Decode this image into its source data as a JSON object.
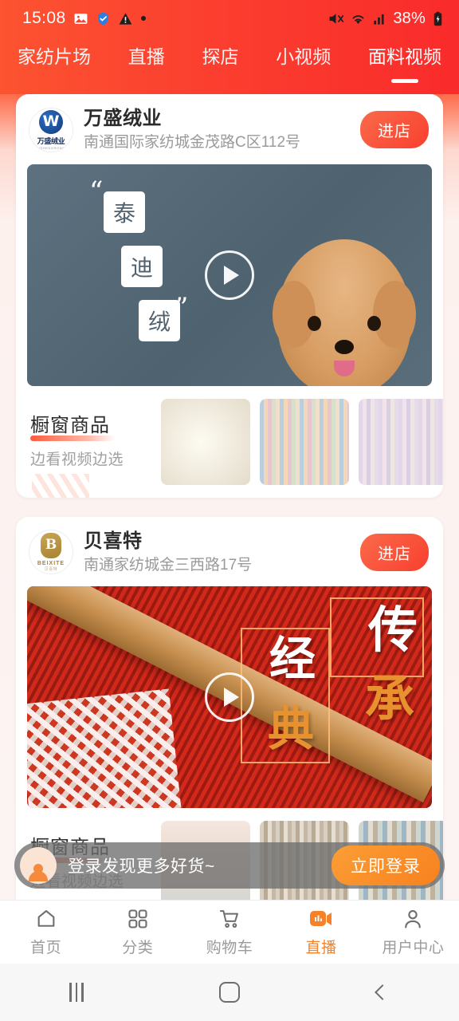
{
  "status_bar": {
    "time": "15:08",
    "battery_percent": "38%",
    "left_icons": [
      "photo-icon",
      "shield-icon",
      "warning-icon",
      "dot-icon"
    ],
    "right_icons": [
      "mute-icon",
      "wifi-icon",
      "signal-icon",
      "battery-charging-icon"
    ]
  },
  "header": {
    "accent_color": "#fb3f2f",
    "gradient_from": "#fc5330",
    "gradient_to": "#fa2b2b",
    "tabs": [
      {
        "label": "家纺片场",
        "active": false
      },
      {
        "label": "直播",
        "active": false
      },
      {
        "label": "探店",
        "active": false
      },
      {
        "label": "小视频",
        "active": false
      },
      {
        "label": "面料视频",
        "active": true
      }
    ]
  },
  "feed": {
    "cards": [
      {
        "shop_name": "万盛绒业",
        "shop_address": "南通国际家纺城金茂路C区112号",
        "enter_label": "进店",
        "logo": {
          "mark": "W",
          "text": "万盛绒业",
          "sub": "WANSHENGRONGYE"
        },
        "video": {
          "caption_chars": [
            "泰",
            "迪",
            "绒"
          ],
          "quote_open": "“",
          "quote_close": "”",
          "play_label": "play-button"
        },
        "showcase": {
          "title": "橱窗商品",
          "subtitle": "边看视频边选",
          "thumbs": [
            "cream-fleece-fabric",
            "pastel-striped-fabric-rolls",
            "lavender-striped-fabric-rolls"
          ]
        }
      },
      {
        "shop_name": "贝喜特",
        "shop_address": "南通家纺城金三西路17号",
        "enter_label": "进店",
        "logo": {
          "mark": "B",
          "text": "BEIXITE",
          "sub": "贝喜特"
        },
        "video": {
          "caption_chars": [
            "传",
            "承",
            "经",
            "典"
          ],
          "play_label": "play-button"
        },
        "showcase": {
          "title": "橱窗商品",
          "subtitle": "边看视频边选",
          "thumbs": [
            "letter-print-bedding",
            "fabric-roll-stack",
            "folded-fabric-stack"
          ]
        }
      }
    ]
  },
  "login_banner": {
    "message": "登录发现更多好货~",
    "button_label": "立即登录",
    "button_color": "#f8811f"
  },
  "bottom_nav": {
    "active_color": "#f5822a",
    "items": [
      {
        "label": "首页",
        "icon": "home-icon",
        "active": false
      },
      {
        "label": "分类",
        "icon": "grid-icon",
        "active": false
      },
      {
        "label": "购物车",
        "icon": "cart-icon",
        "active": false
      },
      {
        "label": "直播",
        "icon": "live-video-icon",
        "active": true
      },
      {
        "label": "用户中心",
        "icon": "user-icon",
        "active": false
      }
    ]
  },
  "android_nav": {
    "recents": "recents-button",
    "home": "home-button",
    "back": "back-button"
  }
}
